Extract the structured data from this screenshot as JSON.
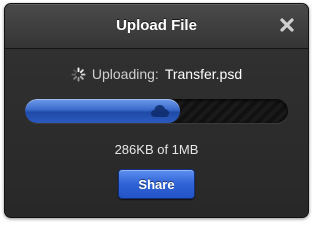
{
  "dialog": {
    "title": "Upload File",
    "close_icon": "close-x-icon"
  },
  "upload": {
    "status_prefix": "Uploading:",
    "filename": "Transfer.psd",
    "spinner_icon": "spinner-icon",
    "progress_fraction": 0.59,
    "progress_icon": "cloud-icon",
    "size_text": "286KB of 1MB",
    "fill_color": "#2f63d6"
  },
  "actions": {
    "share_label": "Share"
  }
}
